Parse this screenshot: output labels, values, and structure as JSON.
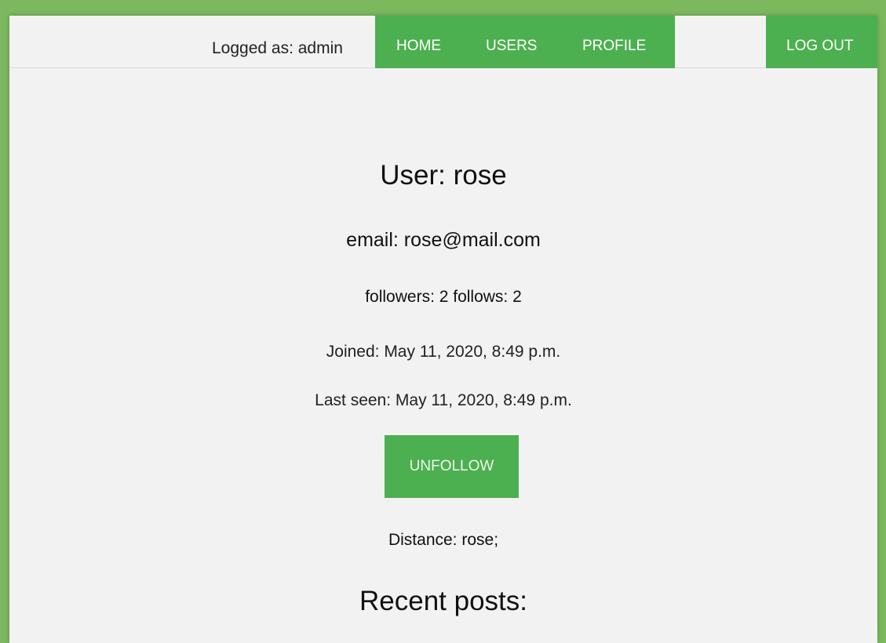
{
  "header": {
    "logged_as": "Logged as: admin",
    "nav": {
      "home": "HOME",
      "users": "USERS",
      "profile": "PROFILE",
      "logout": "LOG OUT"
    }
  },
  "profile": {
    "title": "User: rose",
    "email": "email: rose@mail.com",
    "follows": "followers: 2 follows: 2",
    "joined": "Joined: May 11, 2020, 8:49 p.m.",
    "last_seen": "Last seen: May 11, 2020, 8:49 p.m.",
    "unfollow_label": "UNFOLLOW",
    "distance": "Distance: rose;",
    "recent_posts_heading": "Recent posts:"
  },
  "colors": {
    "accent": "#4caf50",
    "page_border": "#7cb95e",
    "background": "#f2f2f2"
  }
}
